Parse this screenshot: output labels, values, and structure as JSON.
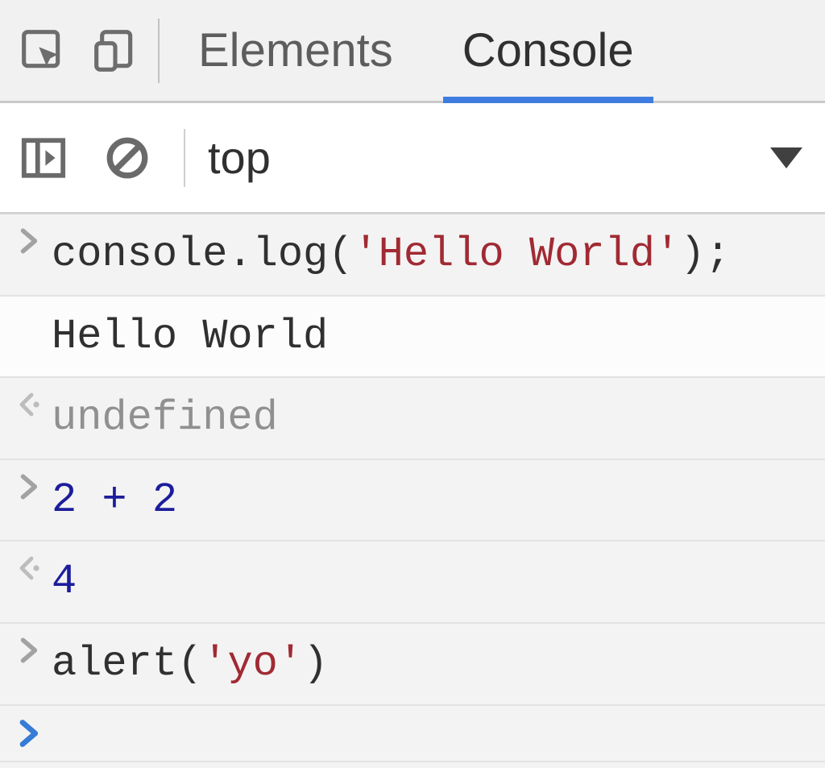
{
  "tabs": {
    "elements": "Elements",
    "console": "Console",
    "active": "console"
  },
  "toolbar": {
    "context": "top"
  },
  "lines": [
    {
      "kind": "input",
      "segments": [
        {
          "cls": "txt-default",
          "t": "console.log("
        },
        {
          "cls": "txt-string",
          "t": "'Hello World'"
        },
        {
          "cls": "txt-default",
          "t": ");"
        }
      ]
    },
    {
      "kind": "output",
      "segments": [
        {
          "cls": "txt-default",
          "t": "Hello World"
        }
      ]
    },
    {
      "kind": "return",
      "segments": [
        {
          "cls": "txt-undef",
          "t": "undefined"
        }
      ]
    },
    {
      "kind": "input",
      "segments": [
        {
          "cls": "txt-number",
          "t": "2 + 2"
        }
      ]
    },
    {
      "kind": "return",
      "segments": [
        {
          "cls": "txt-number",
          "t": "4"
        }
      ]
    },
    {
      "kind": "input",
      "segments": [
        {
          "cls": "txt-default",
          "t": "alert("
        },
        {
          "cls": "txt-string",
          "t": "'yo'"
        },
        {
          "cls": "txt-default",
          "t": ")"
        }
      ]
    }
  ]
}
